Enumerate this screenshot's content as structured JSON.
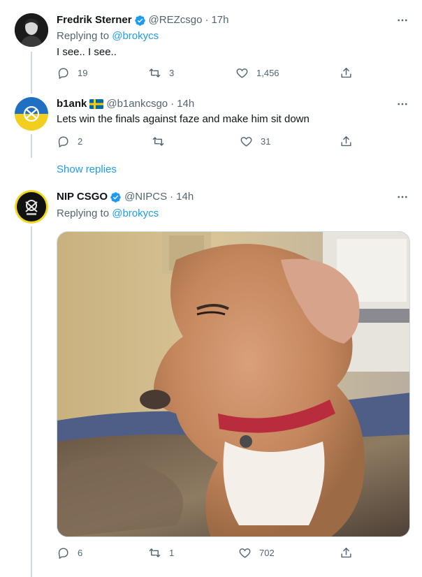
{
  "tweets": [
    {
      "name": "Fredrik Sterner",
      "verified": true,
      "handle": "@REZcsgo",
      "separator": "·",
      "time": "17h",
      "replying_prefix": "Replying to",
      "replying_to": "@brokycs",
      "text": "I see.. I see..",
      "replies": "19",
      "retweets": "3",
      "likes": "1,456"
    },
    {
      "name": "b1ank",
      "flag": "Sweden",
      "handle": "@b1ankcsgo",
      "separator": "·",
      "time": "14h",
      "text": "Lets win the finals against faze and make him sit down",
      "replies": "2",
      "retweets": "",
      "likes": "31"
    },
    {
      "name": "NIP CSGO",
      "verified": true,
      "handle": "@NIPCS",
      "separator": "·",
      "time": "14h",
      "replying_prefix": "Replying to",
      "replying_to": "@brokycs",
      "media": "photo of a brown and white dog with a red collar",
      "replies": "6",
      "retweets": "1",
      "likes": "702"
    }
  ],
  "show_replies_label": "Show replies",
  "colors": {
    "accent": "#1d9bf0",
    "secondary_text": "#536471",
    "thread_line": "#cfd9de"
  },
  "icons": [
    "reply-icon",
    "retweet-icon",
    "like-icon",
    "share-icon",
    "more-icon",
    "verified-icon"
  ]
}
